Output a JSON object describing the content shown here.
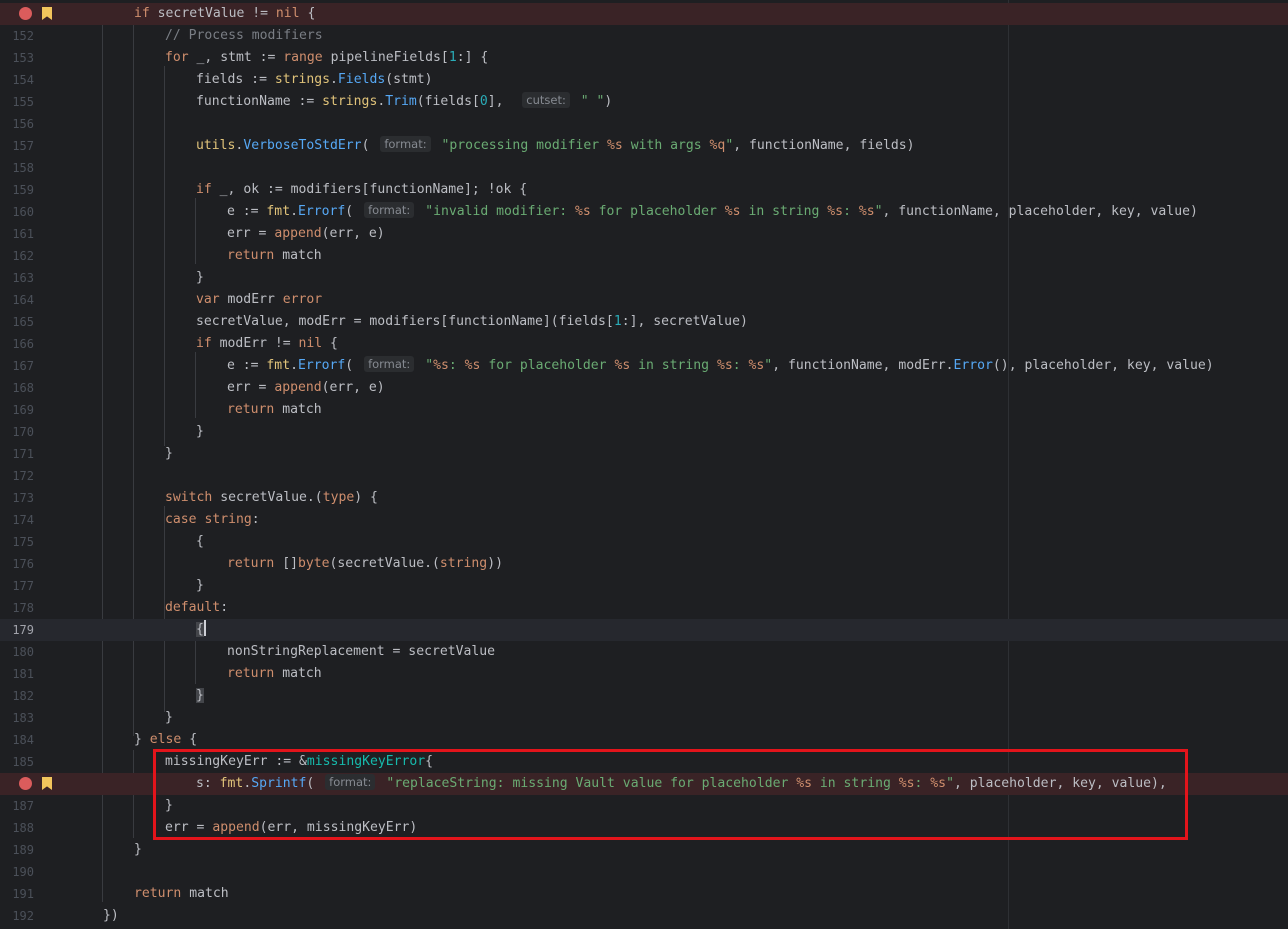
{
  "editor": {
    "language": "Go",
    "current_line": "179",
    "lines": [
      {
        "n": "",
        "text": "if secretValue != nil {"
      },
      {
        "n": "152",
        "text": "// Process modifiers"
      },
      {
        "n": "153",
        "text": "for _, stmt := range pipelineFields[1:] {"
      },
      {
        "n": "154",
        "text": "fields := strings.Fields(stmt)"
      },
      {
        "n": "155",
        "text": "functionName := strings.Trim(fields[0],  cutset: \" \")"
      },
      {
        "n": "156",
        "text": ""
      },
      {
        "n": "157",
        "text": "utils.VerboseToStdErr( format: \"processing modifier %s with args %q\", functionName, fields)"
      },
      {
        "n": "158",
        "text": ""
      },
      {
        "n": "159",
        "text": "if _, ok := modifiers[functionName]; !ok {"
      },
      {
        "n": "160",
        "text": "e := fmt.Errorf( format: \"invalid modifier: %s for placeholder %s in string %s: %s\", functionName, placeholder, key, value)"
      },
      {
        "n": "161",
        "text": "err = append(err, e)"
      },
      {
        "n": "162",
        "text": "return match"
      },
      {
        "n": "163",
        "text": "}"
      },
      {
        "n": "164",
        "text": "var modErr error"
      },
      {
        "n": "165",
        "text": "secretValue, modErr = modifiers[functionName](fields[1:], secretValue)"
      },
      {
        "n": "166",
        "text": "if modErr != nil {"
      },
      {
        "n": "167",
        "text": "e := fmt.Errorf( format: \"%s: %s for placeholder %s in string %s: %s\", functionName, modErr.Error(), placeholder, key, value)"
      },
      {
        "n": "168",
        "text": "err = append(err, e)"
      },
      {
        "n": "169",
        "text": "return match"
      },
      {
        "n": "170",
        "text": "}"
      },
      {
        "n": "171",
        "text": "}"
      },
      {
        "n": "172",
        "text": ""
      },
      {
        "n": "173",
        "text": "switch secretValue.(type) {"
      },
      {
        "n": "174",
        "text": "case string:"
      },
      {
        "n": "175",
        "text": "{"
      },
      {
        "n": "176",
        "text": "return []byte(secretValue.(string))"
      },
      {
        "n": "177",
        "text": "}"
      },
      {
        "n": "178",
        "text": "default:"
      },
      {
        "n": "179",
        "text": "{"
      },
      {
        "n": "180",
        "text": "nonStringReplacement = secretValue"
      },
      {
        "n": "181",
        "text": "return match"
      },
      {
        "n": "182",
        "text": "}"
      },
      {
        "n": "183",
        "text": "}"
      },
      {
        "n": "184",
        "text": "} else {"
      },
      {
        "n": "185",
        "text": "missingKeyErr := &missingKeyError{"
      },
      {
        "n": "",
        "text": "s: fmt.Sprintf( format: \"replaceString: missing Vault value for placeholder %s in string %s: %s\", placeholder, key, value),"
      },
      {
        "n": "187",
        "text": "}"
      },
      {
        "n": "188",
        "text": "err = append(err, missingKeyErr)"
      },
      {
        "n": "189",
        "text": "}"
      },
      {
        "n": "190",
        "text": ""
      },
      {
        "n": "191",
        "text": "return match"
      },
      {
        "n": "192",
        "text": "})"
      }
    ],
    "breakpoint_lines": [
      "151",
      "186"
    ],
    "bookmark_lines": [
      "151",
      "186"
    ],
    "colors": {
      "background": "#1e1f22",
      "keyword": "#cf8e6d",
      "string": "#6aab73",
      "number": "#2aacb8",
      "comment": "#7a7e85",
      "function_call": "#56a8f5",
      "breakpoint": "#db5c5c",
      "bookmark": "#f2c55c",
      "highlight_box": "#e3141b"
    }
  }
}
